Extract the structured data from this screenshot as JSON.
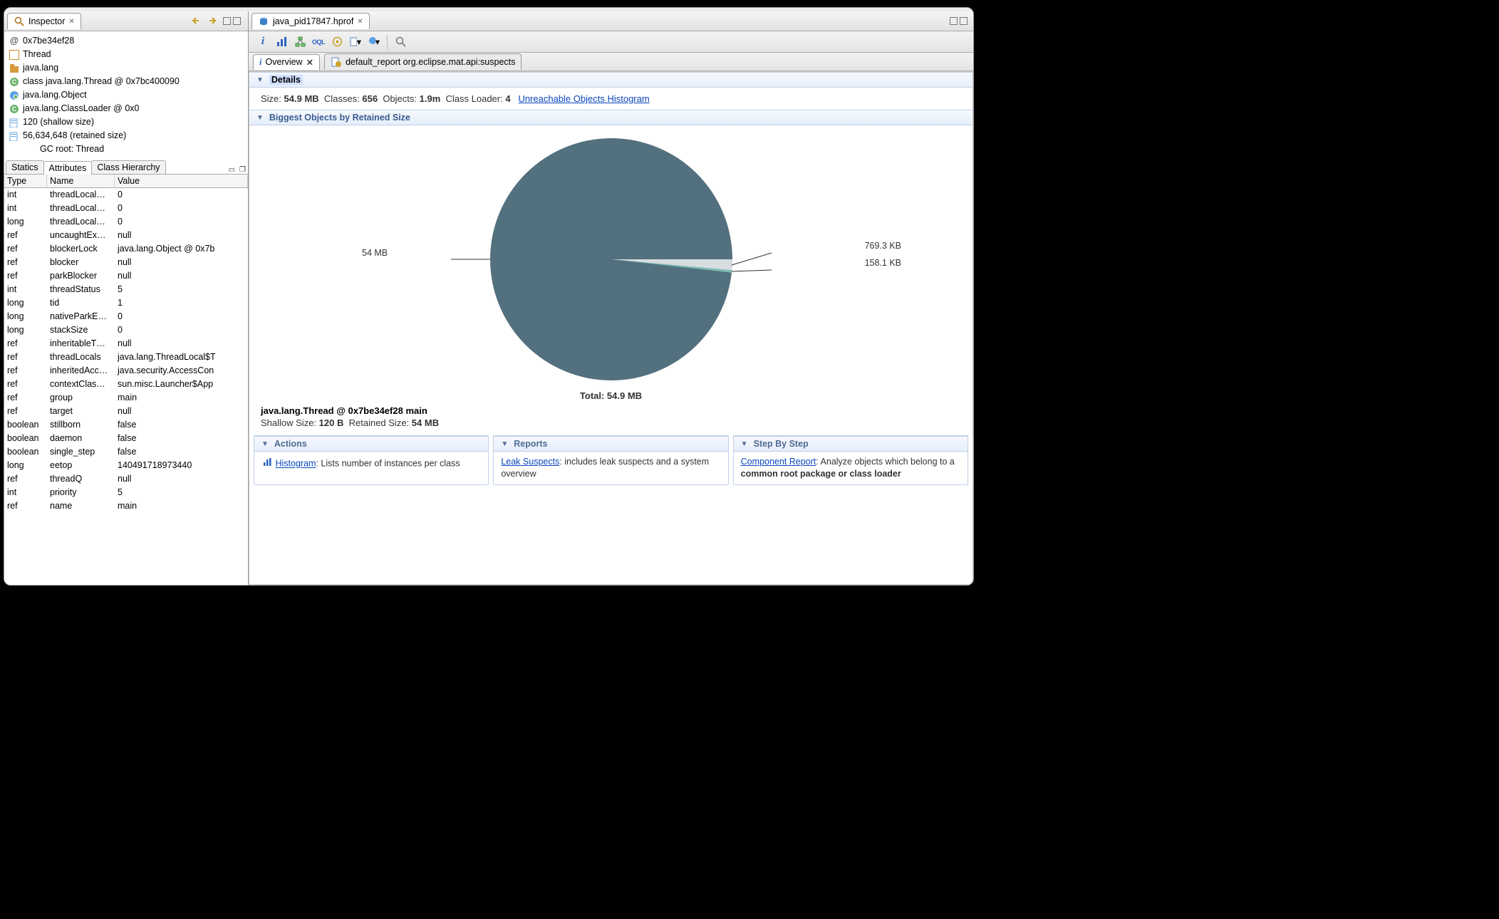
{
  "inspector": {
    "title": "Inspector",
    "tree": [
      {
        "icon": "at",
        "text": "0x7be34ef28"
      },
      {
        "icon": "page",
        "text": "Thread"
      },
      {
        "icon": "pkg",
        "text": "java.lang"
      },
      {
        "icon": "class",
        "text": "class java.lang.Thread @ 0x7bc400090"
      },
      {
        "icon": "obj",
        "text": "java.lang.Object"
      },
      {
        "icon": "class",
        "text": "java.lang.ClassLoader @ 0x0"
      },
      {
        "icon": "size",
        "text": "120 (shallow size)"
      },
      {
        "icon": "size",
        "text": "56,634,648 (retained size)"
      },
      {
        "icon": "none",
        "text": "GC root: Thread",
        "indent": 1
      }
    ],
    "subtabs": [
      "Statics",
      "Attributes",
      "Class Hierarchy"
    ],
    "col_headers": {
      "t": "Type",
      "n": "Name",
      "v": "Value"
    },
    "attrs": [
      {
        "t": "int",
        "n": "threadLocal…",
        "v": "0"
      },
      {
        "t": "int",
        "n": "threadLocal…",
        "v": "0"
      },
      {
        "t": "long",
        "n": "threadLocal…",
        "v": "0"
      },
      {
        "t": "ref",
        "n": "uncaughtEx…",
        "v": "null"
      },
      {
        "t": "ref",
        "n": "blockerLock",
        "v": "java.lang.Object @ 0x7b"
      },
      {
        "t": "ref",
        "n": "blocker",
        "v": "null"
      },
      {
        "t": "ref",
        "n": "parkBlocker",
        "v": "null"
      },
      {
        "t": "int",
        "n": "threadStatus",
        "v": "5"
      },
      {
        "t": "long",
        "n": "tid",
        "v": "1"
      },
      {
        "t": "long",
        "n": "nativeParkE…",
        "v": "0"
      },
      {
        "t": "long",
        "n": "stackSize",
        "v": "0"
      },
      {
        "t": "ref",
        "n": "inheritableT…",
        "v": "null"
      },
      {
        "t": "ref",
        "n": "threadLocals",
        "v": "java.lang.ThreadLocal$T"
      },
      {
        "t": "ref",
        "n": "inheritedAcc…",
        "v": "java.security.AccessCon"
      },
      {
        "t": "ref",
        "n": "contextClas…",
        "v": "sun.misc.Launcher$App"
      },
      {
        "t": "ref",
        "n": "group",
        "v": "main"
      },
      {
        "t": "ref",
        "n": "target",
        "v": "null"
      },
      {
        "t": "boolean",
        "n": "stillborn",
        "v": "false"
      },
      {
        "t": "boolean",
        "n": "daemon",
        "v": "false"
      },
      {
        "t": "boolean",
        "n": "single_step",
        "v": "false"
      },
      {
        "t": "long",
        "n": "eetop",
        "v": "140491718973440"
      },
      {
        "t": "ref",
        "n": "threadQ",
        "v": "null"
      },
      {
        "t": "int",
        "n": "priority",
        "v": "5"
      },
      {
        "t": "ref",
        "n": "name",
        "v": "main"
      }
    ]
  },
  "editor_tab": "java_pid17847.hprof",
  "overview_tab": "Overview",
  "report_tab_label": "default_report  org.eclipse.mat.api:suspects",
  "details": {
    "section": "Details",
    "size_l": "Size:",
    "size_v": "54.9 MB",
    "classes_l": "Classes:",
    "classes_v": "656",
    "objects_l": "Objects:",
    "objects_v": "1.9m",
    "loader_l": "Class Loader:",
    "loader_v": "4",
    "link": "Unreachable Objects Histogram"
  },
  "biggest": {
    "section": "Biggest Objects by Retained Size",
    "total": "Total: 54.9 MB"
  },
  "chart_data": {
    "type": "pie",
    "title": "Biggest Objects by Retained Size",
    "total": "54.9 MB",
    "slices": [
      {
        "label": "54 MB",
        "value": 54.0,
        "unit": "MB",
        "color": "#53707e"
      },
      {
        "label": "769.3 KB",
        "value": 0.7513,
        "unit": "MB",
        "color": "#d7dde1"
      },
      {
        "label": "158.1 KB",
        "value": 0.1544,
        "unit": "MB",
        "color": "#7bbdb1"
      }
    ]
  },
  "selected_object": {
    "head": "java.lang.Thread @ 0x7be34ef28 main",
    "shallow_l": "Shallow Size:",
    "shallow_v": "120 B",
    "retained_l": "Retained Size:",
    "retained_v": "54 MB"
  },
  "actions": {
    "title": "Actions",
    "hist_l": "Histogram",
    "hist_t": ": Lists number of instances per class"
  },
  "reports": {
    "title": "Reports",
    "leak_l": "Leak Suspects",
    "leak_t": ": includes leak suspects and a system overview"
  },
  "steps": {
    "title": "Step By Step",
    "comp_l": "Component Report",
    "comp_t": ": Analyze objects which belong to a ",
    "comp_b": "common root package or class loader"
  }
}
